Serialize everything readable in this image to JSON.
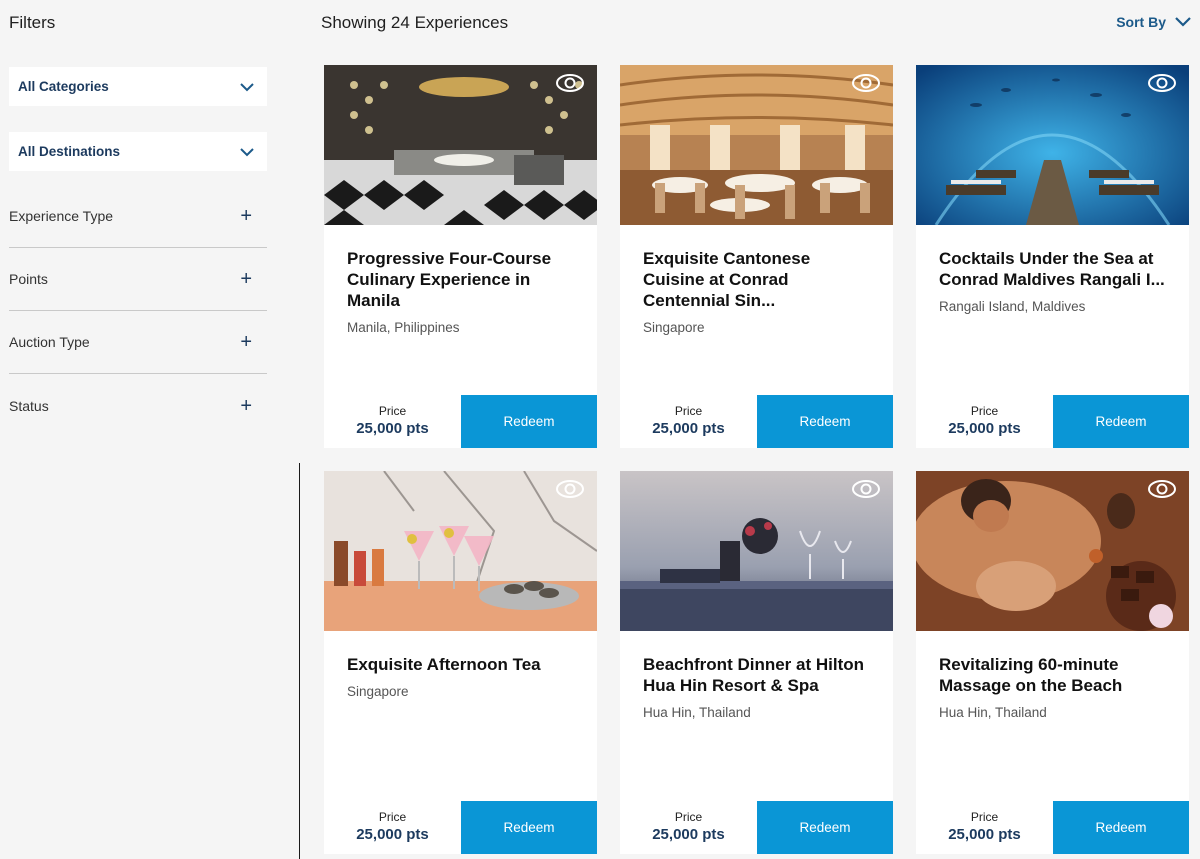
{
  "sidebar": {
    "title": "Filters",
    "dropdowns": [
      {
        "label": "All Categories"
      },
      {
        "label": "All Destinations"
      }
    ],
    "accordions": [
      {
        "label": "Experience Type"
      },
      {
        "label": "Points"
      },
      {
        "label": "Auction Type"
      },
      {
        "label": "Status"
      }
    ]
  },
  "main": {
    "showing": "Showing 24 Experiences",
    "sort_label": "Sort By",
    "price_label": "Price",
    "redeem_label": "Redeem",
    "cards": [
      {
        "title": "Progressive Four-Course Culinary Experience in Manila",
        "location": "Manila, Philippines",
        "price": "25,000 pts"
      },
      {
        "title": "Exquisite Cantonese Cuisine at Conrad Centennial Sin...",
        "location": "Singapore",
        "price": "25,000 pts"
      },
      {
        "title": "Cocktails Under the Sea at Conrad Maldives Rangali I...",
        "location": "Rangali Island, Maldives",
        "price": "25,000 pts"
      },
      {
        "title": "Exquisite Afternoon Tea",
        "location": "Singapore",
        "price": "25,000 pts"
      },
      {
        "title": "Beachfront Dinner at Hilton Hua Hin Resort & Spa",
        "location": "Hua Hin, Thailand",
        "price": "25,000 pts"
      },
      {
        "title": "Revitalizing 60-minute Massage on the Beach",
        "location": "Hua Hin, Thailand",
        "price": "25,000 pts"
      }
    ]
  },
  "colors": {
    "accent": "#0a96d6",
    "navy": "#1c3a5e"
  }
}
